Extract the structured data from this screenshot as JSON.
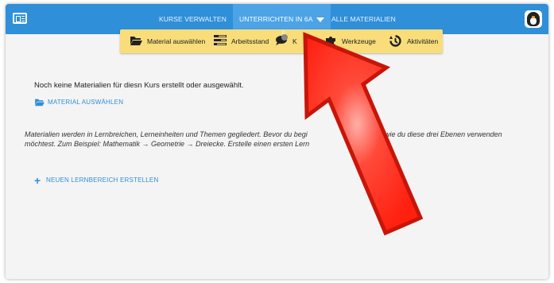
{
  "topnav": {
    "items": [
      "KURSE VERWALTEN",
      "UNTERRICHTEN IN 6A",
      "ALLE MATERIALIEN"
    ]
  },
  "subnav": {
    "items": [
      {
        "label": "Material auswählen",
        "icon": "folder-open-icon"
      },
      {
        "label": "Arbeitsstand",
        "icon": "progress-list-icon"
      },
      {
        "label": "K",
        "icon": "comments-icon",
        "badge": "0"
      },
      {
        "label": "Werkzeuge",
        "icon": "puzzle-icon"
      },
      {
        "label": "Aktivitäten",
        "icon": "history-icon"
      }
    ]
  },
  "main": {
    "empty_message": "Noch keine Materialien für diesn Kurs erstellt oder ausgewählt.",
    "select_material_link": "MATERIAL AUSWÄHLEN",
    "info_line1": "Materialien werden in Lernbreichen, Lerneinheiten und Themen gegliedert. Bevor du begi",
    "info_line1_end": "e dir, wie du diese drei Ebenen verwenden",
    "info_line2": "möchtest. Zum Beispiel: Mathematik → Geometrie → Dreiecke. Erstelle einen ersten Lern",
    "new_area_link": "NEUEN LERNBEREICH ERSTELLEN"
  },
  "colors": {
    "topbar": "#2f8fd8",
    "subbar": "#f8dd7a",
    "link": "#2f8fd8",
    "arrow": "#ff2a1a"
  }
}
